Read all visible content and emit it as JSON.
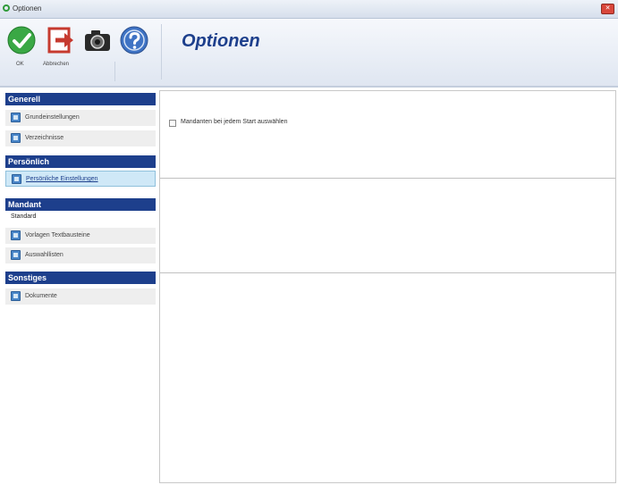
{
  "window": {
    "title": "Optionen",
    "close_label": "✕"
  },
  "ribbon": {
    "ok_label": "OK",
    "cancel_label": "Abbrechen",
    "heading": "Optionen"
  },
  "nav": {
    "groups": [
      {
        "header": "Generell",
        "items": [
          "Grundeinstellungen",
          "Verzeichnisse"
        ]
      },
      {
        "header": "Persönlich",
        "items": [
          "Persönliche Einstellungen"
        ]
      },
      {
        "header": "Mandant",
        "plain": "Standard",
        "items": [
          "Vorlagen Textbausteine",
          "Auswahllisten"
        ]
      },
      {
        "header": "Sonstiges",
        "items": [
          "Dokumente"
        ]
      }
    ],
    "active_item": "Persönliche Einstellungen"
  },
  "main": {
    "checkbox_label": "Mandanten bei jedem Start auswählen",
    "checkbox_checked": false
  },
  "colors": {
    "accent": "#1d3f8c",
    "active_item_bg": "#cfe8f7",
    "ok_green": "#2f9a3a",
    "cancel_red": "#d9473b"
  }
}
